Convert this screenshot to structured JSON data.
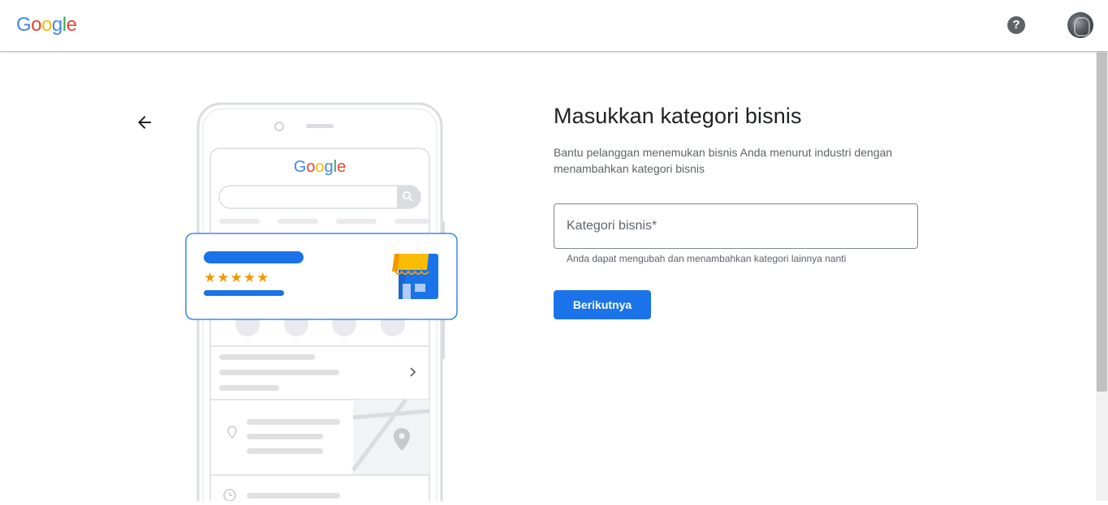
{
  "header": {
    "logo_letters": [
      {
        "ch": "G",
        "color": "#4285F4"
      },
      {
        "ch": "o",
        "color": "#EA4335"
      },
      {
        "ch": "o",
        "color": "#FBBC05"
      },
      {
        "ch": "g",
        "color": "#4285F4"
      },
      {
        "ch": "l",
        "color": "#34A853"
      },
      {
        "ch": "e",
        "color": "#EA4335"
      }
    ],
    "help_icon": "help-circle-icon",
    "help_glyph": "?",
    "avatar_icon": "account-avatar"
  },
  "illustration": {
    "logo_text": "Google",
    "rating_stars": 5,
    "star_glyphs": "★★★★★"
  },
  "form": {
    "title": "Masukkan kategori bisnis",
    "description": "Bantu pelanggan menemukan bisnis Anda menurut industri dengan menambahkan kategori bisnis",
    "category_placeholder": "Kategori bisnis*",
    "category_value": "",
    "hint": "Anda dapat mengubah dan menambahkan kategori lainnya nanti",
    "next_label": "Berikutnya"
  },
  "colors": {
    "accent": "#1A73E8",
    "star": "#F29900",
    "awning": "#FBBC04"
  }
}
